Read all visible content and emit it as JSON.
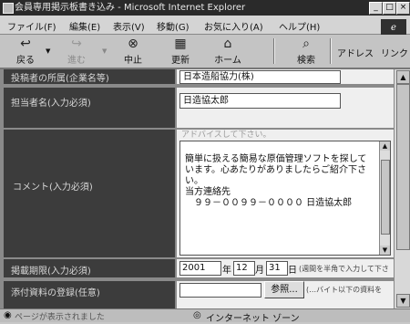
{
  "window": {
    "title": "会員専用掲示板書き込み - Microsoft Internet Explorer",
    "buttons": [
      "_",
      "□",
      "×"
    ]
  },
  "menu": [
    "ファイル(F)",
    "編集(E)",
    "表示(V)",
    "移動(G)",
    "お気に入り(A)",
    "ヘルプ(H)"
  ],
  "toolbar": {
    "back": "戻る",
    "forward": "進む",
    "stop": "中止",
    "refresh": "更新",
    "home": "ホーム",
    "search": "検索",
    "address": "アドレス",
    "links": "リンク"
  },
  "form": {
    "company_label": "投稿者の所属(企業名等)",
    "company_value": "日本造船協力(株)",
    "person_label": "担当者名(入力必須)",
    "person_value": "日造協太郎",
    "comment_label": "コメント(入力必須)",
    "comment_placeholder": "アドバイスして下さい。",
    "comment_lines": [
      "簡単に扱える簡易な原価管理ソフトを探して",
      "います。心あたりがありましたらご紹介下さ",
      "い。",
      "当方連絡先",
      "　９９－００９９－００００ 日造協太郎"
    ],
    "deadline_label": "掲載期限(入力必須)",
    "deadline_year": "2001",
    "deadline_year_unit": "年",
    "deadline_month": "12",
    "deadline_month_unit": "月",
    "deadline_day": "31",
    "deadline_day_unit": "日",
    "deadline_note": "(週間を半角で入力して下さ",
    "attach_label": "添付資料の登録(任意)",
    "browse_button": "参照...",
    "attach_note": "(…バイト以下の資料を"
  },
  "status": {
    "left": "ページが表示されました",
    "zone": "インターネット ゾーン"
  }
}
